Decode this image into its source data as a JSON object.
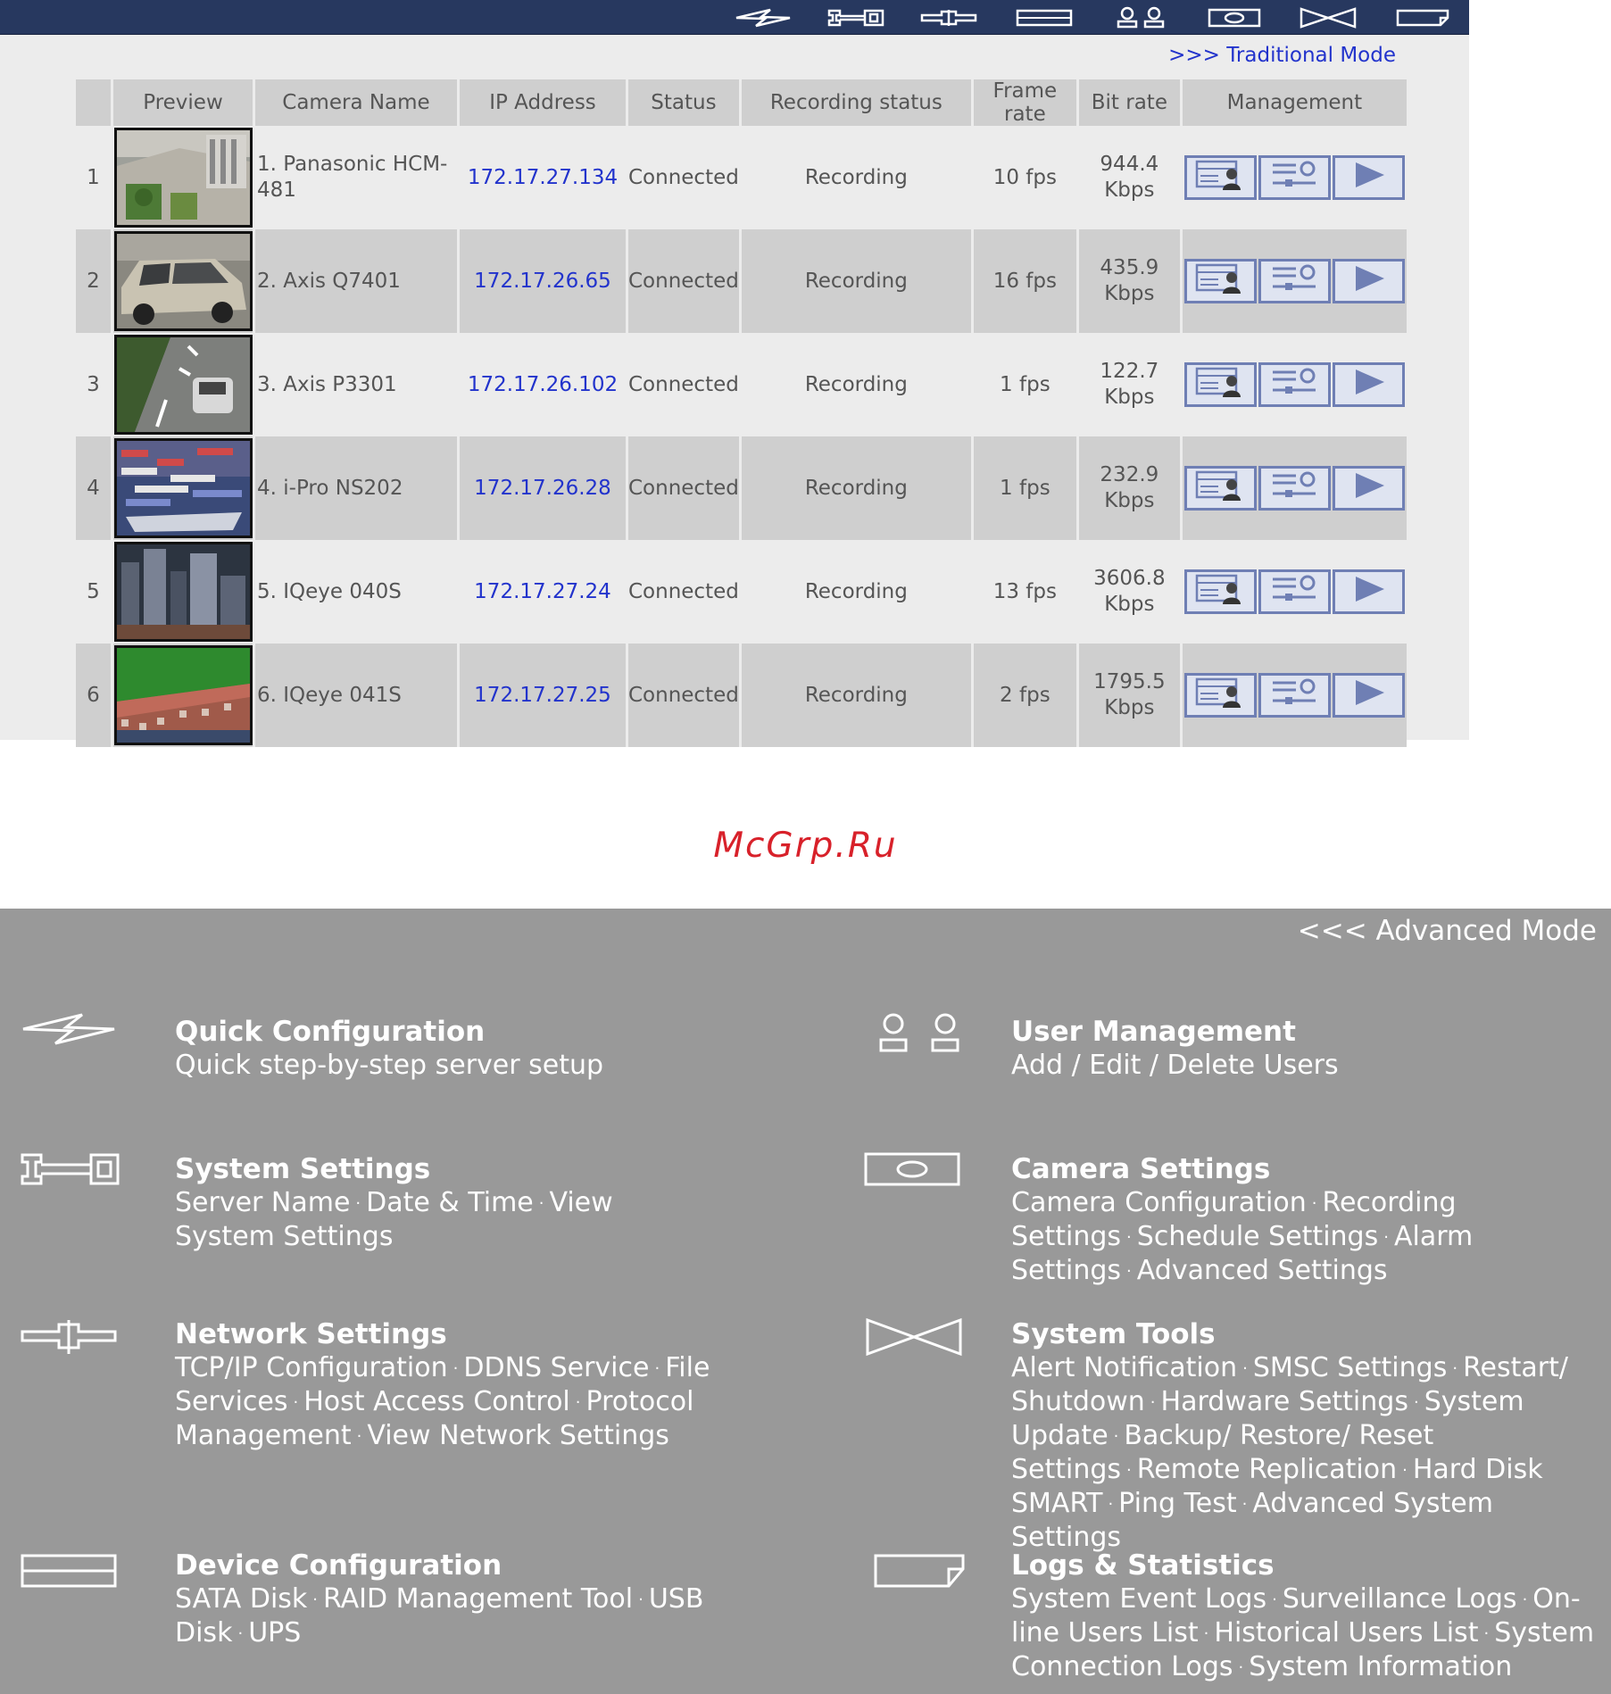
{
  "topbar": {
    "icons": [
      "quick-config-icon",
      "system-settings-icon",
      "network-settings-icon",
      "device-config-icon",
      "user-management-icon",
      "camera-settings-icon",
      "system-tools-icon",
      "logs-statistics-icon"
    ]
  },
  "advanced": {
    "traditional_link": ">>> Traditional Mode",
    "table": {
      "headers": [
        "",
        "Preview",
        "Camera Name",
        "IP Address",
        "Status",
        "Recording status",
        "Frame rate",
        "Bit rate",
        "Management"
      ],
      "rows": [
        {
          "num": "1",
          "name": "1. Panasonic HCM-481",
          "ip": "172.17.27.134",
          "status": "Connected",
          "rec": "Recording",
          "fps": "10 fps",
          "bit": "944.4",
          "unit": "Kbps",
          "thumb": "plaza"
        },
        {
          "num": "2",
          "name": "2. Axis Q7401",
          "ip": "172.17.26.65",
          "status": "Connected",
          "rec": "Recording",
          "fps": "16 fps",
          "bit": "435.9",
          "unit": "Kbps",
          "thumb": "car"
        },
        {
          "num": "3",
          "name": "3. Axis P3301",
          "ip": "172.17.26.102",
          "status": "Connected",
          "rec": "Recording",
          "fps": "1 fps",
          "bit": "122.7",
          "unit": "Kbps",
          "thumb": "road"
        },
        {
          "num": "4",
          "name": "4. i-Pro NS202",
          "ip": "172.17.26.28",
          "status": "Connected",
          "rec": "Recording",
          "fps": "1 fps",
          "bit": "232.9",
          "unit": "Kbps",
          "thumb": "port"
        },
        {
          "num": "5",
          "name": "5. IQeye 040S",
          "ip": "172.17.27.24",
          "status": "Connected",
          "rec": "Recording",
          "fps": "13 fps",
          "bit": "3606.8",
          "unit": "Kbps",
          "thumb": "city"
        },
        {
          "num": "6",
          "name": "6. IQeye 041S",
          "ip": "172.17.27.25",
          "status": "Connected",
          "rec": "Recording",
          "fps": "2 fps",
          "bit": "1795.5",
          "unit": "Kbps",
          "thumb": "stadium"
        }
      ]
    }
  },
  "watermark": "McGrp.Ru",
  "traditional": {
    "advanced_link": "<<< Advanced Mode",
    "menu": [
      {
        "id": "quick-configuration",
        "icon": "quick-config-icon",
        "title": "Quick Configuration",
        "items": [
          "Quick step-by-step server setup"
        ],
        "plain": true
      },
      {
        "id": "user-management",
        "icon": "user-management-icon",
        "title": "User Management",
        "items": [
          "Add / Edit / Delete Users"
        ],
        "plain": true
      },
      {
        "id": "system-settings",
        "icon": "system-settings-icon",
        "title": "System Settings",
        "items": [
          "Server Name",
          "Date & Time",
          "View System Settings"
        ]
      },
      {
        "id": "camera-settings",
        "icon": "camera-settings-icon",
        "title": "Camera Settings",
        "items": [
          "Camera Configuration",
          "Recording Settings",
          "Schedule Settings",
          "Alarm Settings",
          "Advanced Settings"
        ]
      },
      {
        "id": "network-settings",
        "icon": "network-settings-icon",
        "title": "Network Settings",
        "items": [
          "TCP/IP Configuration",
          "DDNS Service",
          "File Services",
          "Host Access Control",
          "Protocol Management",
          "View Network Settings"
        ]
      },
      {
        "id": "system-tools",
        "icon": "system-tools-icon",
        "title": "System Tools",
        "items": [
          "Alert Notification",
          "SMSC Settings",
          "Restart/ Shutdown",
          "Hardware Settings",
          "System Update",
          "Backup/ Restore/ Reset Settings",
          "Remote Replication",
          "Hard Disk SMART",
          "Ping Test",
          "Advanced System Settings"
        ]
      },
      {
        "id": "device-configuration",
        "icon": "device-config-icon",
        "title": "Device Configuration",
        "items": [
          "SATA Disk",
          "RAID Management Tool",
          "USB Disk",
          "UPS"
        ]
      },
      {
        "id": "logs-statistics",
        "icon": "logs-statistics-icon",
        "title": "Logs & Statistics",
        "items": [
          "System Event Logs",
          "Surveillance Logs",
          "On-line Users List",
          "Historical Users List",
          "System Connection Logs",
          "System Information"
        ]
      }
    ]
  }
}
